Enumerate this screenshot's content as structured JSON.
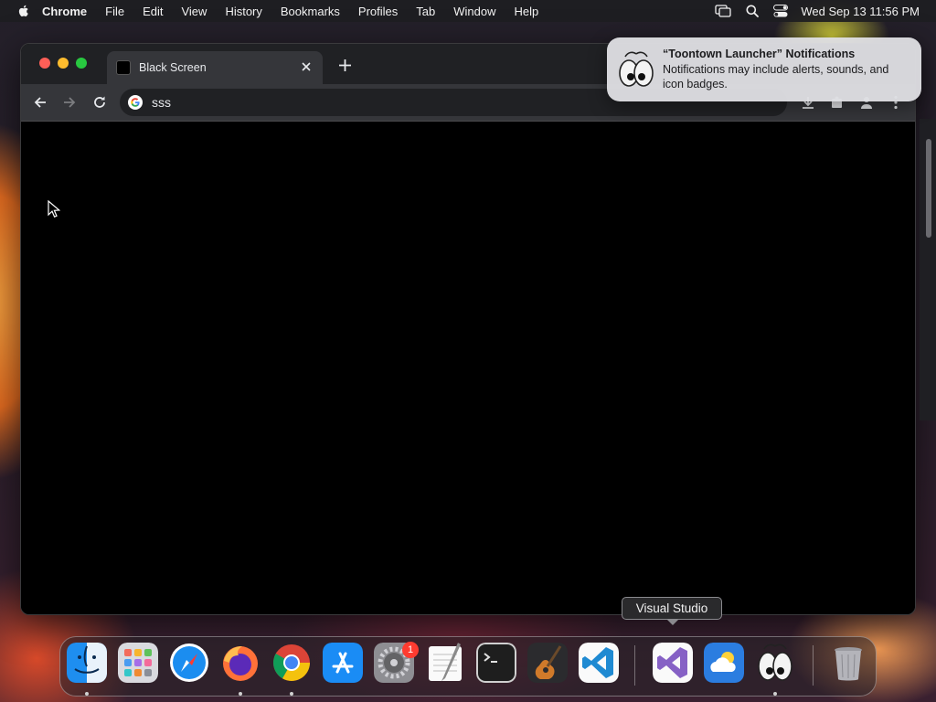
{
  "menubar": {
    "app_name": "Chrome",
    "items": [
      "File",
      "Edit",
      "View",
      "History",
      "Bookmarks",
      "Profiles",
      "Tab",
      "Window",
      "Help"
    ],
    "clock": "Wed Sep 13  11:56 PM"
  },
  "browser": {
    "tab_title": "Black Screen",
    "address": "sss"
  },
  "notification": {
    "title": "“Toontown Launcher” Notifications",
    "body": "Notifications may include alerts, sounds, and icon badges."
  },
  "tooltip": "Visual Studio",
  "dock": {
    "items": [
      "finder",
      "launchpad",
      "safari",
      "firefox",
      "chrome",
      "app-store",
      "system-settings",
      "textedit",
      "terminal",
      "garageband",
      "vscode",
      "visual-studio",
      "weather",
      "toontown-launcher",
      "trash"
    ],
    "settings_badge": "1"
  },
  "colors": {
    "window_bg": "#000000",
    "tab_active": "#35363a",
    "tabstrip": "#202124",
    "close": "#ff5f57",
    "minimize": "#febc2e",
    "maximize": "#28c840"
  }
}
